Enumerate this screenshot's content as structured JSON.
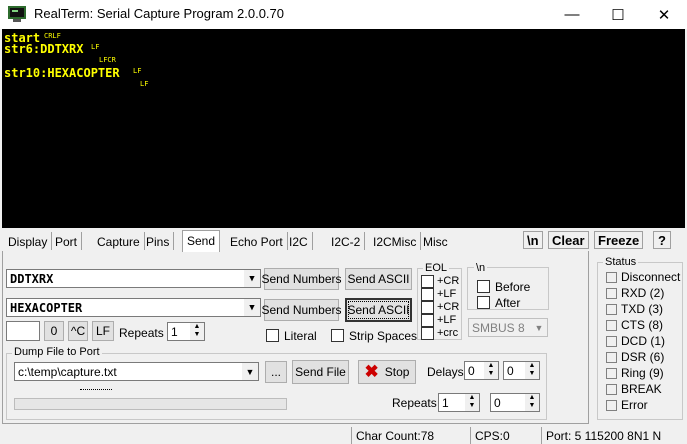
{
  "window": {
    "title": "RealTerm: Serial Capture Program 2.0.0.70",
    "minimize": "—",
    "maximize": "☐",
    "close": "✕"
  },
  "terminal": {
    "lines": [
      {
        "text": "start",
        "ctl": "CRLF"
      },
      {
        "text": "str6:DDTXRX",
        "ctl": "LF"
      },
      {
        "text": "",
        "ctl": "LFCR"
      },
      {
        "text": "str10:HEXACOPTER",
        "ctl": "LF"
      },
      {
        "text": "",
        "ctl": "LF"
      }
    ]
  },
  "tabs": [
    "Display",
    "Port",
    "Capture",
    "Pins",
    "Send",
    "Echo Port",
    "I2C",
    "I2C-2",
    "I2CMisc",
    "Misc"
  ],
  "active_tab": "Send",
  "right_buttons": {
    "newline": "\\n",
    "clear": "Clear",
    "freeze": "Freeze",
    "help": "?"
  },
  "send": {
    "line1_value": "DDTXRX",
    "line2_value": "HEXACOPTER",
    "send_numbers": "Send Numbers",
    "send_ascii": "Send ASCII",
    "zero_btn": "0",
    "ctrl_c_btn": "^C",
    "lf_btn": "LF",
    "repeats_label": "Repeats",
    "repeats_value": "1",
    "literal_label": "Literal",
    "strip_spaces_label": "Strip Spaces"
  },
  "eol": {
    "title": "EOL",
    "items": [
      "+CR",
      "+LF",
      "+CR",
      "+LF",
      "+crc"
    ]
  },
  "newline_group": {
    "title": "\\n",
    "before": "Before",
    "after": "After",
    "smbus": "SMBUS 8"
  },
  "dump": {
    "title": "Dump File to Port",
    "file_value": "c:\\temp\\capture.txt",
    "browse": "...",
    "send_file": "Send File",
    "stop": "Stop",
    "delays_label": "Delays",
    "delay1": "0",
    "delay2": "0",
    "repeats_label": "Repeats",
    "repeat1": "1",
    "repeat2": "0",
    "progress": 0
  },
  "status": {
    "title": "Status",
    "items": [
      "Disconnect",
      "RXD (2)",
      "TXD (3)",
      "CTS (8)",
      "DCD (1)",
      "DSR (6)",
      "Ring (9)",
      "BREAK",
      "Error"
    ]
  },
  "statusbar": {
    "char_count": "Char Count:78",
    "cps": "CPS:0",
    "port": "Port: 5 115200 8N1 N"
  },
  "colors": {
    "terminal_bg": "#000000",
    "terminal_fg": "#ffff00",
    "stop_icon": "#cc0000"
  }
}
